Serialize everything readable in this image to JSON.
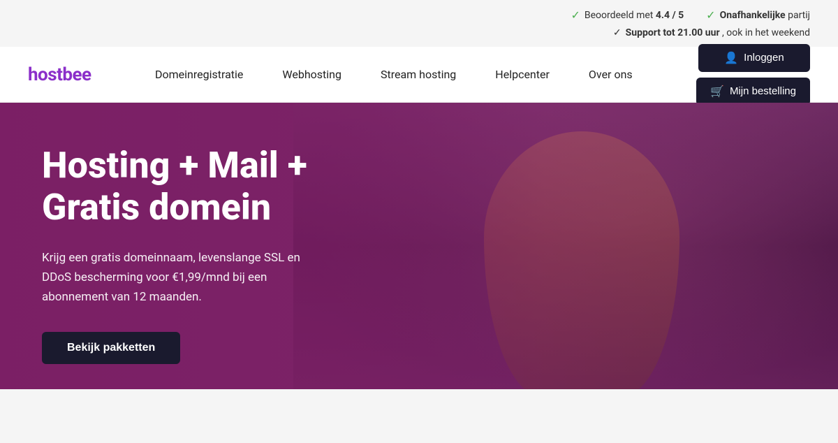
{
  "top_bar": {
    "rating_prefix": "Beoordeeld met ",
    "rating_value": "4.4 / 5",
    "independent_label": "Onafhankelijke",
    "independent_suffix": " partij",
    "support_label": "Support tot 21.00 uur",
    "support_suffix": " , ook in het weekend"
  },
  "nav": {
    "logo": "hostbee",
    "items": [
      {
        "id": "domeinregistratie",
        "label": "Domeinregistratie"
      },
      {
        "id": "webhosting",
        "label": "Webhosting"
      },
      {
        "id": "stream-hosting",
        "label": "Stream hosting"
      },
      {
        "id": "helpcenter",
        "label": "Helpcenter"
      },
      {
        "id": "over-ons",
        "label": "Over ons"
      }
    ],
    "btn_login": "Inloggen",
    "btn_order": "Mijn bestelling"
  },
  "hero": {
    "title_line1": "Hosting + Mail +",
    "title_line2": "Gratis domein",
    "subtitle": "Krijg een gratis domeinnaam, levenslange SSL en DDoS bescherming voor €1,99/mnd bij een abonnement van 12 maanden.",
    "cta_label": "Bekijk pakketten"
  },
  "icons": {
    "check": "✓",
    "user": "👤",
    "cart": "🛒"
  }
}
